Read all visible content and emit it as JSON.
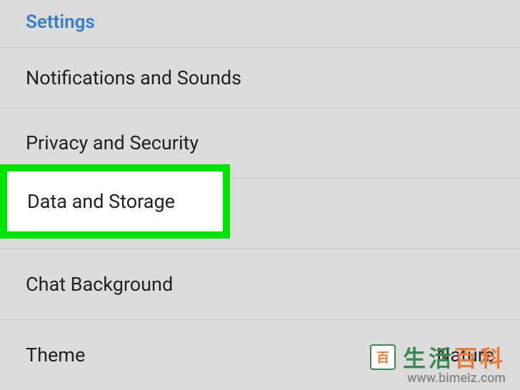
{
  "header": {
    "title": "Settings"
  },
  "menu": {
    "notifications": "Notifications and Sounds",
    "privacy": "Privacy and Security",
    "storage": "Data and Storage",
    "background": "Chat Background",
    "theme": "Theme",
    "theme_value": "Nature"
  },
  "highlight": {
    "label": "Data and Storage"
  },
  "watermark": {
    "cn1": "生活",
    "cn2": "百科",
    "url": "www.bimeiz.com"
  }
}
